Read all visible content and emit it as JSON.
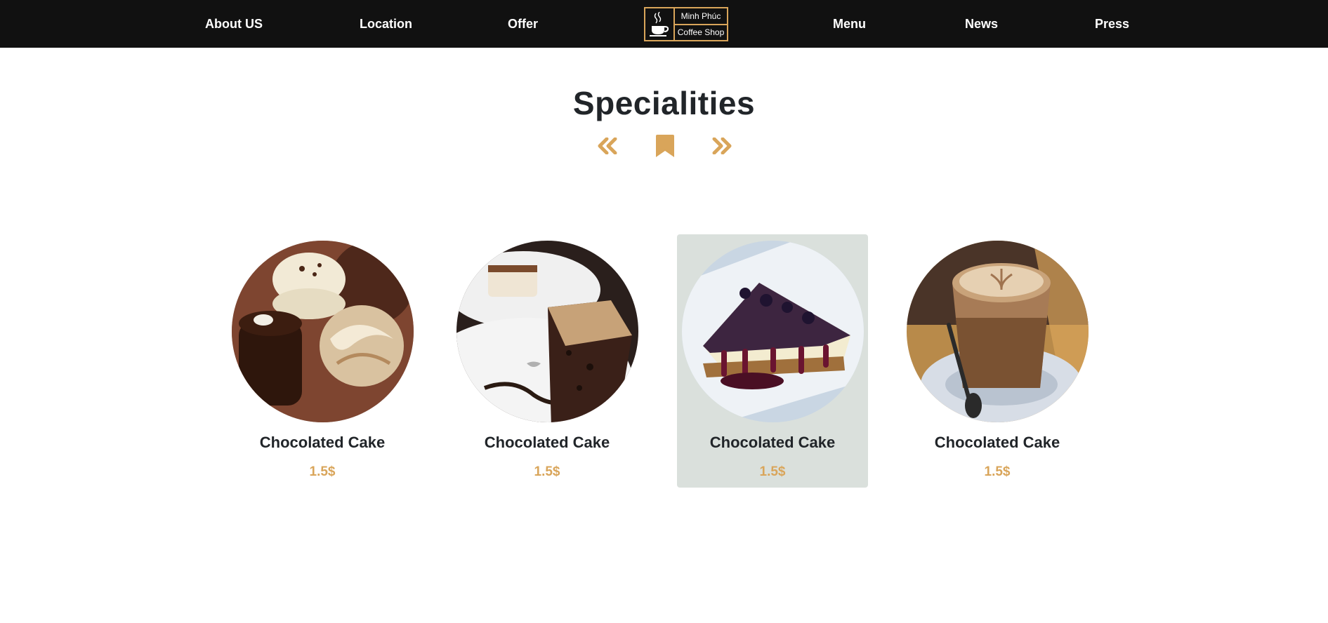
{
  "colors": {
    "accent": "#d9a55a",
    "navbar_bg": "#111111",
    "active_card_bg": "#dae0dc",
    "text_dark": "#212529"
  },
  "nav": {
    "left": [
      {
        "label": "About US"
      },
      {
        "label": "Location"
      },
      {
        "label": "Offer"
      }
    ],
    "right": [
      {
        "label": "Menu"
      },
      {
        "label": "News"
      },
      {
        "label": "Press"
      }
    ],
    "logo": {
      "icon": "coffee-cup-icon",
      "line1": "Minh Phúc",
      "line2": "Coffee Shop"
    }
  },
  "section": {
    "title": "Specialities",
    "controls": {
      "prev_icon": "double-chevron-left-icon",
      "bookmark_icon": "bookmark-icon",
      "next_icon": "double-chevron-right-icon"
    }
  },
  "products": [
    {
      "name": "Chocolated Cake",
      "price": "1.5$",
      "image": "chocolate-truffles-photo",
      "active": false
    },
    {
      "name": "Chocolated Cake",
      "price": "1.5$",
      "image": "chocolate-cake-slice-photo",
      "active": false
    },
    {
      "name": "Chocolated Cake",
      "price": "1.5$",
      "image": "blueberry-cheesecake-photo",
      "active": true
    },
    {
      "name": "Chocolated Cake",
      "price": "1.5$",
      "image": "latte-coffee-photo",
      "active": false
    }
  ]
}
